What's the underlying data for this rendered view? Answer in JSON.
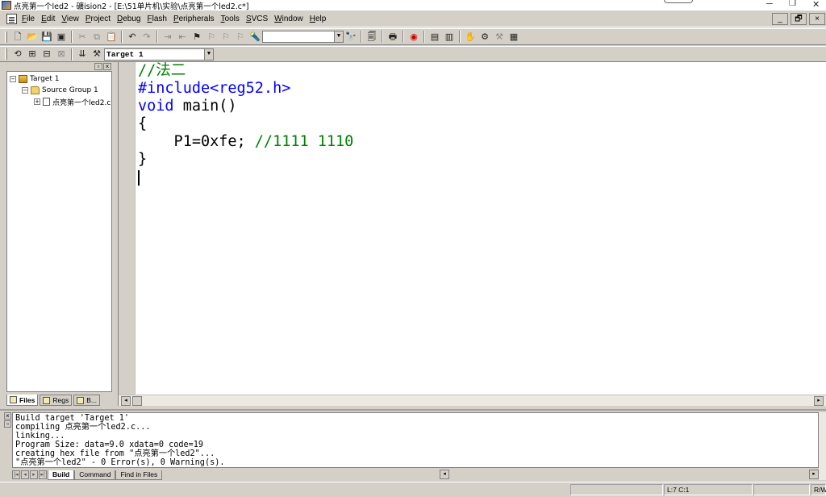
{
  "window": {
    "title": "点亮第一个led2  - 礦ision2 - [E:\\51单片机\\实验\\点亮第一个led2.c*]",
    "min": "─",
    "max": "❐",
    "close": "✕"
  },
  "menu": {
    "items": [
      "File",
      "Edit",
      "View",
      "Project",
      "Debug",
      "Flash",
      "Peripherals",
      "Tools",
      "SVCS",
      "Window",
      "Help"
    ],
    "mdi_min": "_",
    "mdi_restore": "🗗",
    "mdi_close": "×"
  },
  "toolbar2": {
    "target": "Target 1"
  },
  "project": {
    "tree": {
      "target": "Target 1",
      "group": "Source Group 1",
      "file": "点亮第一个led2.c"
    },
    "tabs": {
      "files": "Files",
      "regs": "Regs",
      "books": "B..."
    }
  },
  "editor": {
    "lines": {
      "l1": "//法二",
      "l2": "#include<reg52.h>",
      "l3_kw": "void",
      "l3_rest": " main()",
      "l4": "{",
      "l5_code": "    P1=0xfe; ",
      "l5_comment": "//1111 1110",
      "l6": "}"
    }
  },
  "output": {
    "lines": [
      "Build target 'Target 1'",
      "compiling 点亮第一个led2.c...",
      "linking...",
      "Program Size: data=9.0 xdata=0 code=19",
      "creating hex file from \"点亮第一个led2\"...",
      "\"点亮第一个led2\" - 0 Error(s), 0 Warning(s)."
    ],
    "tabs": {
      "build": "Build",
      "command": "Command",
      "find": "Find in Files"
    }
  },
  "statusbar": {
    "position": "L:7 C:1",
    "mode": "R/W"
  }
}
